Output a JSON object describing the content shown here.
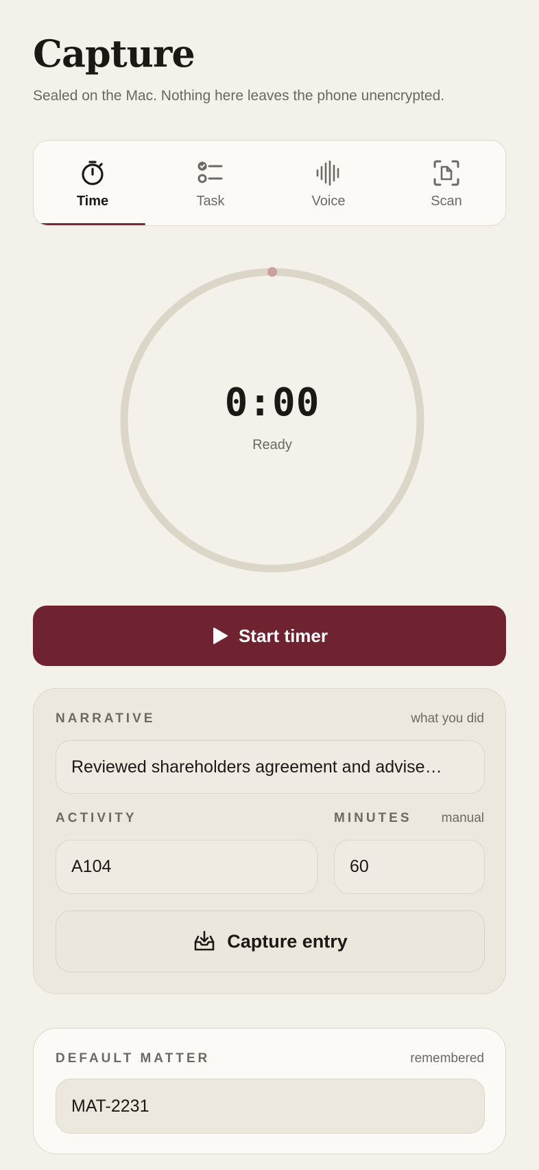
{
  "header": {
    "title": "Capture",
    "subtitle": "Sealed on the Mac. Nothing here leaves the phone unencrypted."
  },
  "tabs": [
    {
      "label": "Time",
      "icon": "stopwatch-icon",
      "active": true
    },
    {
      "label": "Task",
      "icon": "checklist-icon",
      "active": false
    },
    {
      "label": "Voice",
      "icon": "waveform-icon",
      "active": false
    },
    {
      "label": "Scan",
      "icon": "document-scan-icon",
      "active": false
    }
  ],
  "timer": {
    "display": "0:00",
    "state": "Ready",
    "progress": 0
  },
  "start_button": {
    "label": "Start timer",
    "icon": "play-icon"
  },
  "entry": {
    "narrative_label": "NARRATIVE",
    "narrative_hint": "what you did",
    "narrative_value": "Reviewed shareholders agreement and advise…",
    "activity_label": "ACTIVITY",
    "activity_value": "A104",
    "minutes_label": "MINUTES",
    "minutes_hint": "manual",
    "minutes_value": "60",
    "capture_label": "Capture entry",
    "capture_icon": "inbox-tray-icon"
  },
  "matter": {
    "label": "DEFAULT MATTER",
    "hint": "remembered",
    "value": "MAT-2231"
  },
  "colors": {
    "background": "#f4f1eb",
    "accent": "#6f2230",
    "ring": "#dcd6c8",
    "ring_marker": "#c9a0a4"
  }
}
